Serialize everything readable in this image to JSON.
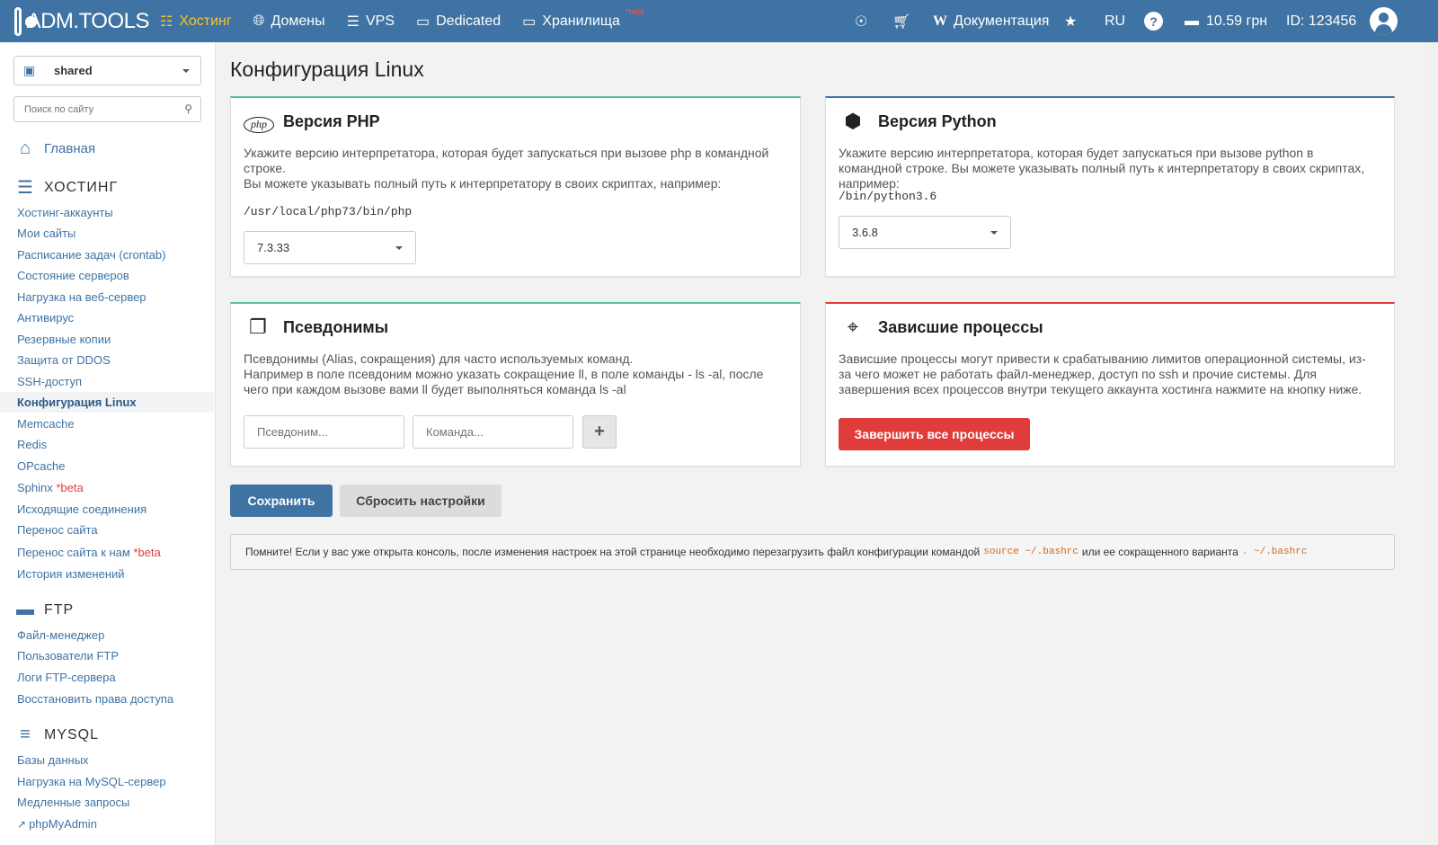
{
  "topbar": {
    "logo": "ADM.TOOLS",
    "nav": [
      {
        "label": "Хостинг",
        "icon": "sitemap-icon"
      },
      {
        "label": "Домены",
        "icon": "globe-icon"
      },
      {
        "label": "VPS",
        "icon": "server-icon"
      },
      {
        "label": "Dedicated",
        "icon": "hdd-icon"
      },
      {
        "label": "Хранилища",
        "icon": "storage-icon",
        "badge": "*beta"
      }
    ],
    "docs_label": "Документация",
    "lang": "RU",
    "balance": "10.59 грн",
    "account_id": "ID: 123456"
  },
  "sidebar": {
    "account": "shared",
    "search_placeholder": "Поиск по сайту",
    "home": "Главная",
    "hosting_title": "ХОСТИНГ",
    "hosting_links": [
      "Хостинг-аккаунты",
      "Мои сайты",
      "Расписание задач (crontab)",
      "Состояние серверов",
      "Нагрузка на веб-сервер",
      "Антивирус",
      "Резервные копии",
      "Защита от DDOS",
      "SSH-доступ",
      "Конфигурация Linux",
      "Memcache",
      "Redis",
      "OPcache",
      "Sphinx",
      "Исходящие соединения",
      "Перенос сайта",
      "Перенос сайта к нам",
      "История изменений"
    ],
    "beta_badge": "*beta",
    "ftp_title": "FTP",
    "ftp_links": [
      "Файл-менеджер",
      "Пользователи FTP",
      "Логи FTP-сервера",
      "Восстановить права доступа"
    ],
    "mysql_title": "MYSQL",
    "mysql_links": [
      "Базы данных",
      "Нагрузка на MySQL-сервер",
      "Медленные запросы",
      "phpMyAdmin"
    ]
  },
  "main": {
    "title": "Конфигурация Linux",
    "php": {
      "title": "Версия PHP",
      "badge": "php",
      "text1": "Укажите версию интерпретатора, которая будет запускаться при вызове php в командной строке.",
      "text2": "Вы можете указывать полный путь к интерпретатору в своих скриптах, например:",
      "path": "/usr/local/php73/bin/php",
      "version": "7.3.33"
    },
    "python": {
      "title": "Версия Python",
      "text": "Укажите версию интерпретатора, которая будет запускаться при вызове python в командной строке. Вы можете указывать полный путь к интерпретатору в своих скриптах, например:",
      "path": "/bin/python3.6",
      "version": "3.6.8"
    },
    "aliases": {
      "title": "Псевдонимы",
      "text1": "Псевдонимы (Alias, сокращения) для часто используемых команд.",
      "text2": "Например в поле псевдоним можно указать сокращение ll, в поле команды - ls -al, после чего при каждом вызове вами ll будет выполняться команда ls -al",
      "alias_placeholder": "Псевдоним...",
      "command_placeholder": "Команда...",
      "add_label": "+"
    },
    "processes": {
      "title": "Зависшие процессы",
      "text": "Зависшие процессы могут привести к срабатыванию лимитов операционной системы, из-за чего может не работать файл-менеджер, доступ по ssh и прочие системы. Для завершения всех процессов внутри текущего аккаунта хостинга нажмите на кнопку ниже.",
      "kill_label": "Завершить все процессы"
    },
    "save_label": "Сохранить",
    "reset_label": "Сбросить настройки",
    "notice": {
      "text1": "Помните! Если у вас уже открыта консоль, после изменения настроек на этой странице необходимо перезагрузить файл конфигурации командой",
      "cmd1": "source ~/.bashrc",
      "text2": "или ее сокращенного варианта",
      "cmd2": ". ~/.bashrc"
    }
  },
  "colors": {
    "topbar": "#3f73a3",
    "active_nav": "#ffc41f",
    "danger": "#e03c3c",
    "card_top_green": "#5abea2"
  }
}
